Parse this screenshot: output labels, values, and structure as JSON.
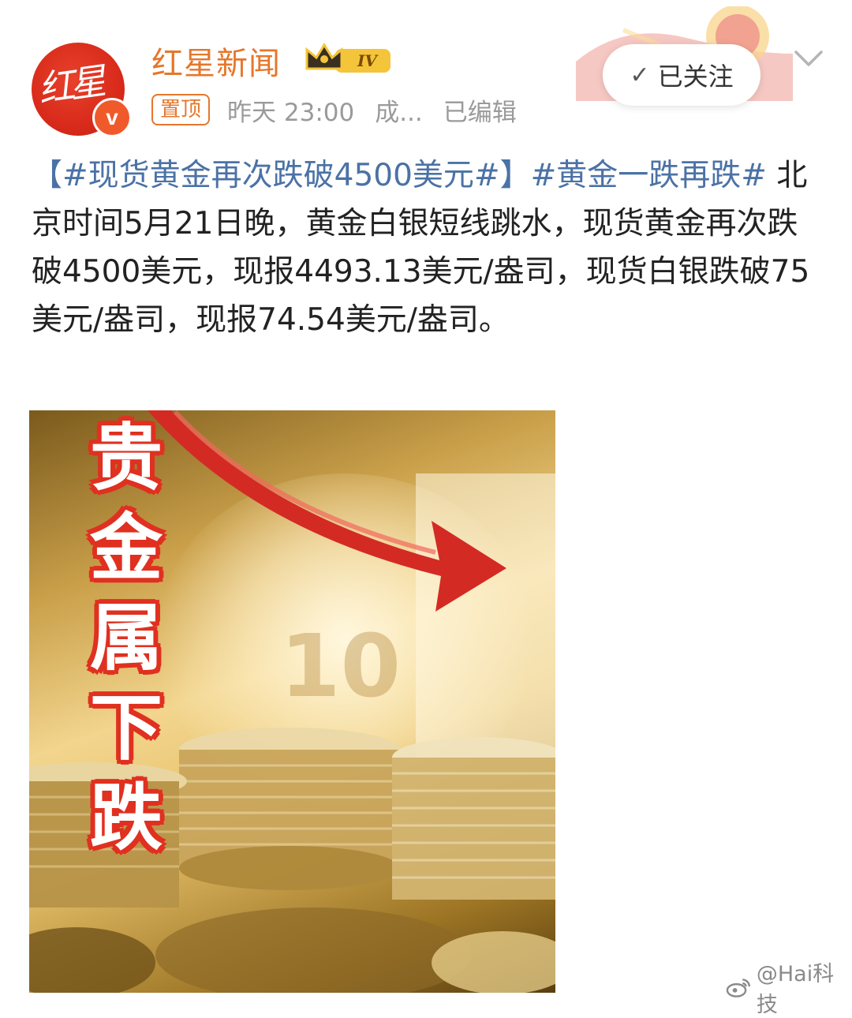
{
  "account": {
    "avatar_text": "红星",
    "name": "红星新闻",
    "level": "IV",
    "pinned_label": "置顶",
    "time": "昨天 23:00",
    "location": "成...",
    "edited": "已编辑",
    "follow_label": "已关注"
  },
  "post": {
    "tag1": "【#现货黄金再次跌破4500美元#】",
    "tag2": "#黄金一跌再跌#",
    "body": " 北京时间5月21日晚，黄金白银短线跳水，现货黄金再次跌破4500美元，现报4493.13美元/盎司，现货白银跌破75美元/盎司，现报74.54美元/盎司。"
  },
  "image": {
    "overlay_text": "贵金属下跌",
    "note_digits": "10"
  },
  "watermark": "@Hai科技",
  "colors": {
    "name": "#e5772b",
    "tag": "#4b72a6",
    "avatar": "#d92b1b",
    "overlay_outline": "#e03020"
  }
}
